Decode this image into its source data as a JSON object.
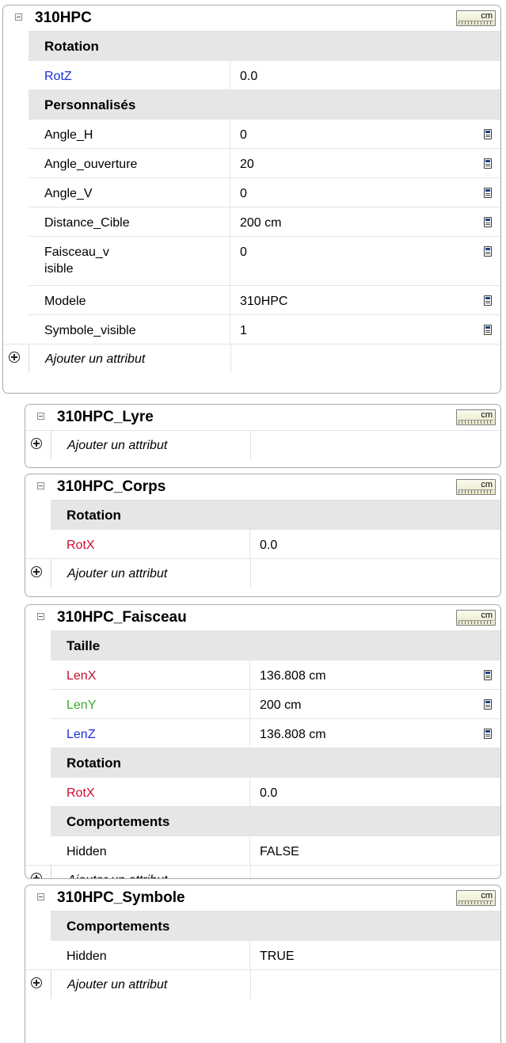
{
  "colors": {
    "blue_axis": "#1c2fd8",
    "red_axis": "#c8102e",
    "green_axis": "#3aa832"
  },
  "add_attribute_label": "Ajouter un attribut",
  "unit_label": "cm",
  "panels": [
    {
      "title": "310HPC",
      "sections": [
        {
          "title": "Rotation",
          "rows": [
            {
              "label": "RotZ",
              "value": "0.0",
              "label_color": "blue",
              "calc": false
            }
          ]
        },
        {
          "title": "Personnalisés",
          "rows": [
            {
              "label": "Angle_H",
              "value": "0",
              "calc": true
            },
            {
              "label": "Angle_ouverture",
              "value": "20",
              "calc": true
            },
            {
              "label": "Angle_V",
              "value": "0",
              "calc": true
            },
            {
              "label": "Distance_Cible",
              "value": "200 cm",
              "calc": true
            },
            {
              "label": "Faisceau_v\nisible",
              "value": "0",
              "calc": true
            },
            {
              "label": "Modele",
              "value": "310HPC",
              "calc": true
            },
            {
              "label": "Symbole_visible",
              "value": "1",
              "calc": true
            }
          ]
        }
      ]
    },
    {
      "title": "310HPC_Lyre",
      "sections": []
    },
    {
      "title": "310HPC_Corps",
      "sections": [
        {
          "title": "Rotation",
          "rows": [
            {
              "label": "RotX",
              "value": "0.0",
              "label_color": "red",
              "calc": false
            }
          ]
        }
      ]
    },
    {
      "title": "310HPC_Faisceau",
      "sections": [
        {
          "title": "Taille",
          "rows": [
            {
              "label": "LenX",
              "value": "136.808 cm",
              "label_color": "red",
              "calc": true
            },
            {
              "label": "LenY",
              "value": "200 cm",
              "label_color": "green",
              "calc": true
            },
            {
              "label": "LenZ",
              "value": "136.808 cm",
              "label_color": "blue",
              "calc": true
            }
          ]
        },
        {
          "title": "Rotation",
          "rows": [
            {
              "label": "RotX",
              "value": "0.0",
              "label_color": "red",
              "calc": false
            }
          ]
        },
        {
          "title": "Comportements",
          "rows": [
            {
              "label": "Hidden",
              "value": "FALSE",
              "calc": false
            }
          ]
        }
      ]
    },
    {
      "title": "310HPC_Symbole",
      "sections": [
        {
          "title": "Comportements",
          "rows": [
            {
              "label": "Hidden",
              "value": "TRUE",
              "calc": false
            }
          ]
        }
      ]
    }
  ]
}
